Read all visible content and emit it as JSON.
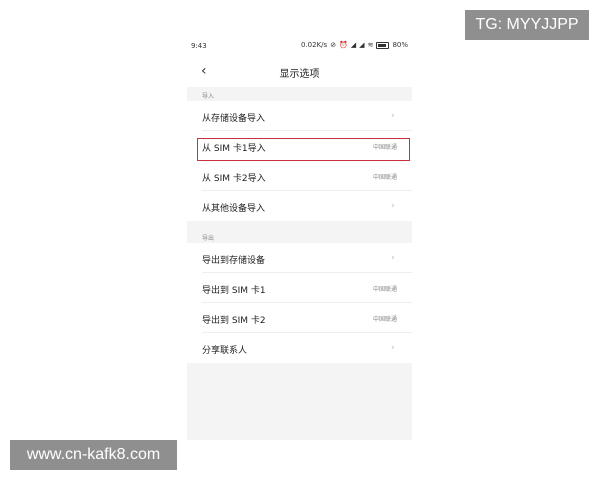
{
  "status_bar": {
    "time": "9:43",
    "net_speed": "0.02K/s",
    "battery": "80%",
    "battery_level": 0.8
  },
  "nav": {
    "title": "显示选项"
  },
  "import_section": {
    "header": "导入",
    "items": [
      {
        "label": "从存储设备导入",
        "value": ""
      },
      {
        "label": "从 SIM 卡1导入",
        "value": "中国联通"
      },
      {
        "label": "从 SIM 卡2导入",
        "value": "中国联通"
      },
      {
        "label": "从其他设备导入",
        "value": ""
      }
    ]
  },
  "export_section": {
    "header": "导出",
    "items": [
      {
        "label": "导出到存储设备",
        "value": ""
      },
      {
        "label": "导出到 SIM 卡1",
        "value": "中国联通"
      },
      {
        "label": "导出到 SIM 卡2",
        "value": "中国联通"
      },
      {
        "label": "分享联系人",
        "value": ""
      }
    ]
  },
  "watermarks": {
    "top_right": "TG: MYYJJPP",
    "bottom_left": "www.cn-kafk8.com"
  },
  "colors": {
    "highlight": "#c9303a"
  }
}
